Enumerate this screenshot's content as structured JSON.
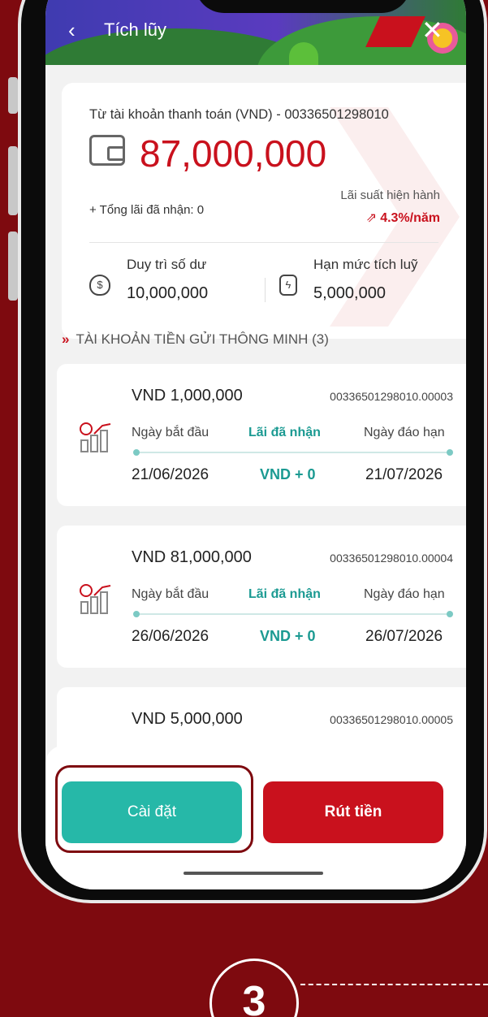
{
  "header": {
    "back_icon": "‹",
    "title": "Tích lũy",
    "close_icon": "✕"
  },
  "balance": {
    "from_account": "Từ tài khoản thanh toán (VND) - 00336501298010",
    "amount": "87,000,000",
    "total_interest": "+ Tổng lãi đã nhận: 0",
    "rate_label": "Lãi suất hiện hành",
    "rate_value": "4.3%/năm",
    "maintain_label": "Duy trì số dư",
    "maintain_value": "10,000,000",
    "limit_label": "Hạn mức tích luỹ",
    "limit_value": "5,000,000"
  },
  "section_title": "TÀI KHOẢN TIỀN GỬI THÔNG MINH (3)",
  "deposits": [
    {
      "amount": "VND 1,000,000",
      "account": "00336501298010.00003",
      "start_label": "Ngày bắt đầu",
      "interest_label": "Lãi đã nhận",
      "end_label": "Ngày đáo hạn",
      "start_date": "21/06/2026",
      "interest": "VND + 0",
      "end_date": "21/07/2026"
    },
    {
      "amount": "VND 81,000,000",
      "account": "00336501298010.00004",
      "start_label": "Ngày bắt đầu",
      "interest_label": "Lãi đã nhận",
      "end_label": "Ngày đáo hạn",
      "start_date": "26/06/2026",
      "interest": "VND + 0",
      "end_date": "26/07/2026"
    },
    {
      "amount": "VND 5,000,000",
      "account": "00336501298010.00005"
    }
  ],
  "actions": {
    "settings": "Cài đặt",
    "withdraw": "Rút tiền"
  },
  "step_number": "3",
  "icons": {
    "wallet": "wallet-icon",
    "shield": "shield-dollar-icon",
    "limit": "bolt-cylinder-icon",
    "deposit": "growth-chart-icon"
  },
  "colors": {
    "brand_red": "#c9111d",
    "teal": "#26b8a8",
    "background": "#7e0a0f"
  }
}
